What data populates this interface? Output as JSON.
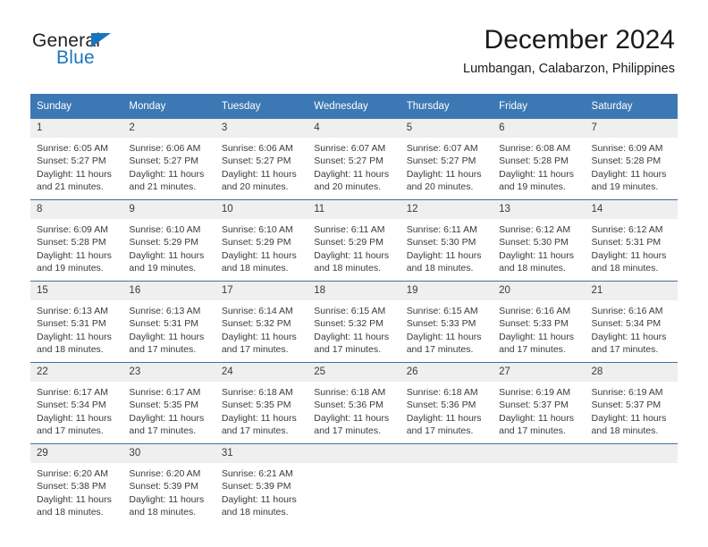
{
  "logo": {
    "primary_text": "General",
    "secondary_text": "Blue",
    "primary_color": "#231f20",
    "secondary_color": "#1b75bc"
  },
  "header": {
    "title": "December 2024",
    "subtitle": "Lumbangan, Calabarzon, Philippines"
  },
  "theme": {
    "header_row_bg": "#3c78b4",
    "header_row_text": "#ffffff",
    "daynum_bg": "#efefef",
    "row_divider": "#3b72a8",
    "body_text": "#3a3a3a"
  },
  "calendar": {
    "day_headers": [
      "Sunday",
      "Monday",
      "Tuesday",
      "Wednesday",
      "Thursday",
      "Friday",
      "Saturday"
    ],
    "weeks": [
      [
        {
          "day": "1",
          "sunrise": "Sunrise: 6:05 AM",
          "sunset": "Sunset: 5:27 PM",
          "daylight_line1": "Daylight: 11 hours",
          "daylight_line2": "and 21 minutes."
        },
        {
          "day": "2",
          "sunrise": "Sunrise: 6:06 AM",
          "sunset": "Sunset: 5:27 PM",
          "daylight_line1": "Daylight: 11 hours",
          "daylight_line2": "and 21 minutes."
        },
        {
          "day": "3",
          "sunrise": "Sunrise: 6:06 AM",
          "sunset": "Sunset: 5:27 PM",
          "daylight_line1": "Daylight: 11 hours",
          "daylight_line2": "and 20 minutes."
        },
        {
          "day": "4",
          "sunrise": "Sunrise: 6:07 AM",
          "sunset": "Sunset: 5:27 PM",
          "daylight_line1": "Daylight: 11 hours",
          "daylight_line2": "and 20 minutes."
        },
        {
          "day": "5",
          "sunrise": "Sunrise: 6:07 AM",
          "sunset": "Sunset: 5:27 PM",
          "daylight_line1": "Daylight: 11 hours",
          "daylight_line2": "and 20 minutes."
        },
        {
          "day": "6",
          "sunrise": "Sunrise: 6:08 AM",
          "sunset": "Sunset: 5:28 PM",
          "daylight_line1": "Daylight: 11 hours",
          "daylight_line2": "and 19 minutes."
        },
        {
          "day": "7",
          "sunrise": "Sunrise: 6:09 AM",
          "sunset": "Sunset: 5:28 PM",
          "daylight_line1": "Daylight: 11 hours",
          "daylight_line2": "and 19 minutes."
        }
      ],
      [
        {
          "day": "8",
          "sunrise": "Sunrise: 6:09 AM",
          "sunset": "Sunset: 5:28 PM",
          "daylight_line1": "Daylight: 11 hours",
          "daylight_line2": "and 19 minutes."
        },
        {
          "day": "9",
          "sunrise": "Sunrise: 6:10 AM",
          "sunset": "Sunset: 5:29 PM",
          "daylight_line1": "Daylight: 11 hours",
          "daylight_line2": "and 19 minutes."
        },
        {
          "day": "10",
          "sunrise": "Sunrise: 6:10 AM",
          "sunset": "Sunset: 5:29 PM",
          "daylight_line1": "Daylight: 11 hours",
          "daylight_line2": "and 18 minutes."
        },
        {
          "day": "11",
          "sunrise": "Sunrise: 6:11 AM",
          "sunset": "Sunset: 5:29 PM",
          "daylight_line1": "Daylight: 11 hours",
          "daylight_line2": "and 18 minutes."
        },
        {
          "day": "12",
          "sunrise": "Sunrise: 6:11 AM",
          "sunset": "Sunset: 5:30 PM",
          "daylight_line1": "Daylight: 11 hours",
          "daylight_line2": "and 18 minutes."
        },
        {
          "day": "13",
          "sunrise": "Sunrise: 6:12 AM",
          "sunset": "Sunset: 5:30 PM",
          "daylight_line1": "Daylight: 11 hours",
          "daylight_line2": "and 18 minutes."
        },
        {
          "day": "14",
          "sunrise": "Sunrise: 6:12 AM",
          "sunset": "Sunset: 5:31 PM",
          "daylight_line1": "Daylight: 11 hours",
          "daylight_line2": "and 18 minutes."
        }
      ],
      [
        {
          "day": "15",
          "sunrise": "Sunrise: 6:13 AM",
          "sunset": "Sunset: 5:31 PM",
          "daylight_line1": "Daylight: 11 hours",
          "daylight_line2": "and 18 minutes."
        },
        {
          "day": "16",
          "sunrise": "Sunrise: 6:13 AM",
          "sunset": "Sunset: 5:31 PM",
          "daylight_line1": "Daylight: 11 hours",
          "daylight_line2": "and 17 minutes."
        },
        {
          "day": "17",
          "sunrise": "Sunrise: 6:14 AM",
          "sunset": "Sunset: 5:32 PM",
          "daylight_line1": "Daylight: 11 hours",
          "daylight_line2": "and 17 minutes."
        },
        {
          "day": "18",
          "sunrise": "Sunrise: 6:15 AM",
          "sunset": "Sunset: 5:32 PM",
          "daylight_line1": "Daylight: 11 hours",
          "daylight_line2": "and 17 minutes."
        },
        {
          "day": "19",
          "sunrise": "Sunrise: 6:15 AM",
          "sunset": "Sunset: 5:33 PM",
          "daylight_line1": "Daylight: 11 hours",
          "daylight_line2": "and 17 minutes."
        },
        {
          "day": "20",
          "sunrise": "Sunrise: 6:16 AM",
          "sunset": "Sunset: 5:33 PM",
          "daylight_line1": "Daylight: 11 hours",
          "daylight_line2": "and 17 minutes."
        },
        {
          "day": "21",
          "sunrise": "Sunrise: 6:16 AM",
          "sunset": "Sunset: 5:34 PM",
          "daylight_line1": "Daylight: 11 hours",
          "daylight_line2": "and 17 minutes."
        }
      ],
      [
        {
          "day": "22",
          "sunrise": "Sunrise: 6:17 AM",
          "sunset": "Sunset: 5:34 PM",
          "daylight_line1": "Daylight: 11 hours",
          "daylight_line2": "and 17 minutes."
        },
        {
          "day": "23",
          "sunrise": "Sunrise: 6:17 AM",
          "sunset": "Sunset: 5:35 PM",
          "daylight_line1": "Daylight: 11 hours",
          "daylight_line2": "and 17 minutes."
        },
        {
          "day": "24",
          "sunrise": "Sunrise: 6:18 AM",
          "sunset": "Sunset: 5:35 PM",
          "daylight_line1": "Daylight: 11 hours",
          "daylight_line2": "and 17 minutes."
        },
        {
          "day": "25",
          "sunrise": "Sunrise: 6:18 AM",
          "sunset": "Sunset: 5:36 PM",
          "daylight_line1": "Daylight: 11 hours",
          "daylight_line2": "and 17 minutes."
        },
        {
          "day": "26",
          "sunrise": "Sunrise: 6:18 AM",
          "sunset": "Sunset: 5:36 PM",
          "daylight_line1": "Daylight: 11 hours",
          "daylight_line2": "and 17 minutes."
        },
        {
          "day": "27",
          "sunrise": "Sunrise: 6:19 AM",
          "sunset": "Sunset: 5:37 PM",
          "daylight_line1": "Daylight: 11 hours",
          "daylight_line2": "and 17 minutes."
        },
        {
          "day": "28",
          "sunrise": "Sunrise: 6:19 AM",
          "sunset": "Sunset: 5:37 PM",
          "daylight_line1": "Daylight: 11 hours",
          "daylight_line2": "and 18 minutes."
        }
      ],
      [
        {
          "day": "29",
          "sunrise": "Sunrise: 6:20 AM",
          "sunset": "Sunset: 5:38 PM",
          "daylight_line1": "Daylight: 11 hours",
          "daylight_line2": "and 18 minutes."
        },
        {
          "day": "30",
          "sunrise": "Sunrise: 6:20 AM",
          "sunset": "Sunset: 5:39 PM",
          "daylight_line1": "Daylight: 11 hours",
          "daylight_line2": "and 18 minutes."
        },
        {
          "day": "31",
          "sunrise": "Sunrise: 6:21 AM",
          "sunset": "Sunset: 5:39 PM",
          "daylight_line1": "Daylight: 11 hours",
          "daylight_line2": "and 18 minutes."
        },
        {
          "day": "",
          "sunrise": "",
          "sunset": "",
          "daylight_line1": "",
          "daylight_line2": ""
        },
        {
          "day": "",
          "sunrise": "",
          "sunset": "",
          "daylight_line1": "",
          "daylight_line2": ""
        },
        {
          "day": "",
          "sunrise": "",
          "sunset": "",
          "daylight_line1": "",
          "daylight_line2": ""
        },
        {
          "day": "",
          "sunrise": "",
          "sunset": "",
          "daylight_line1": "",
          "daylight_line2": ""
        }
      ]
    ]
  }
}
